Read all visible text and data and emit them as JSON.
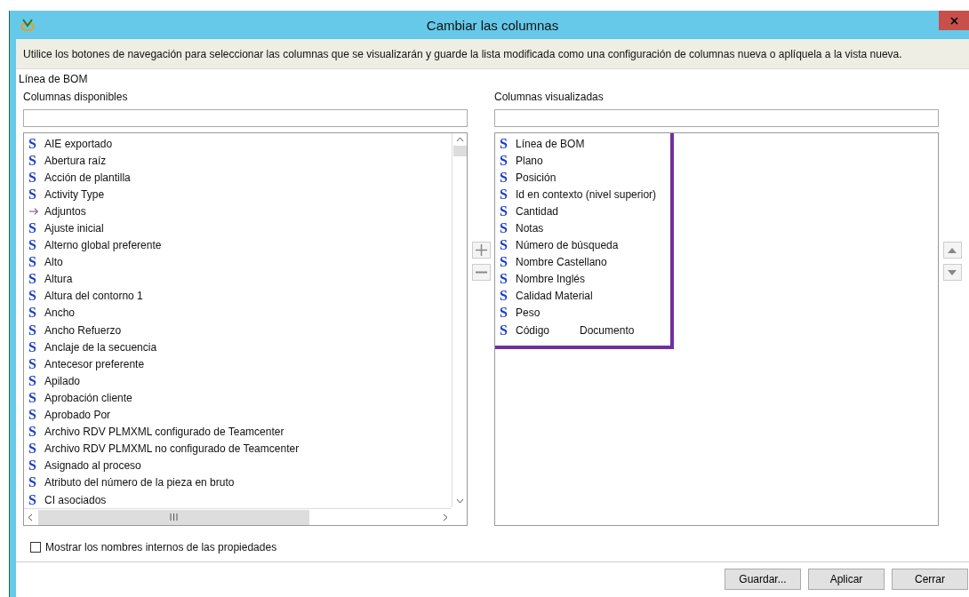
{
  "window": {
    "title": "Cambiar las columnas"
  },
  "instructions": "Utilice los botones de navegación para seleccionar las columnas que se visualizarán y guarde la lista modificada como una configuración de columnas nueva o aplíquela a la vista nueva.",
  "object_type": "Línea de BOM",
  "available": {
    "label": "Columnas disponibles",
    "items": [
      {
        "kind": "string",
        "icon": "S",
        "label": "AIE exportado"
      },
      {
        "kind": "string",
        "icon": "S",
        "label": "Abertura raíz"
      },
      {
        "kind": "string",
        "icon": "S",
        "label": "Acción de plantilla"
      },
      {
        "kind": "string",
        "icon": "S",
        "label": "Activity Type"
      },
      {
        "kind": "reference",
        "label": "Adjuntos"
      },
      {
        "kind": "string",
        "icon": "S",
        "label": "Ajuste inicial"
      },
      {
        "kind": "string",
        "icon": "S",
        "label": "Alterno global preferente"
      },
      {
        "kind": "string",
        "icon": "S",
        "label": "Alto"
      },
      {
        "kind": "string",
        "icon": "S",
        "label": "Altura"
      },
      {
        "kind": "string",
        "icon": "S",
        "label": "Altura del contorno 1"
      },
      {
        "kind": "string",
        "icon": "S",
        "label": "Ancho"
      },
      {
        "kind": "string",
        "icon": "S",
        "label": "Ancho Refuerzo"
      },
      {
        "kind": "string",
        "icon": "S",
        "label": "Anclaje de la secuencia"
      },
      {
        "kind": "string",
        "icon": "S",
        "label": "Antecesor preferente"
      },
      {
        "kind": "string",
        "icon": "S",
        "label": "Apilado"
      },
      {
        "kind": "string",
        "icon": "S",
        "label": "Aprobación cliente"
      },
      {
        "kind": "string",
        "icon": "S",
        "label": "Aprobado Por"
      },
      {
        "kind": "string",
        "icon": "S",
        "label": "Archivo RDV PLMXML configurado de Teamcenter"
      },
      {
        "kind": "string",
        "icon": "S",
        "label": "Archivo RDV PLMXML no configurado de Teamcenter"
      },
      {
        "kind": "string",
        "icon": "S",
        "label": "Asignado al proceso"
      },
      {
        "kind": "string",
        "icon": "S",
        "label": "Atributo del número de la pieza en bruto"
      },
      {
        "kind": "string",
        "icon": "S",
        "label": "CI asociados"
      }
    ]
  },
  "displayed": {
    "label": "Columnas visualizadas",
    "highlighted": true,
    "items": [
      {
        "kind": "string",
        "icon": "S",
        "label": "Línea de BOM"
      },
      {
        "kind": "string",
        "icon": "S",
        "label": "Plano"
      },
      {
        "kind": "string",
        "icon": "S",
        "label": "Posición"
      },
      {
        "kind": "string",
        "icon": "S",
        "label": "Id en contexto (nivel superior)"
      },
      {
        "kind": "string",
        "icon": "S",
        "label": "Cantidad"
      },
      {
        "kind": "string",
        "icon": "S",
        "label": "Notas"
      },
      {
        "kind": "string",
        "icon": "S",
        "label": "Número de búsqueda"
      },
      {
        "kind": "string",
        "icon": "S",
        "label": "Nombre Castellano"
      },
      {
        "kind": "string",
        "icon": "S",
        "label": "Nombre Inglés"
      },
      {
        "kind": "string",
        "icon": "S",
        "label": "Calidad Material"
      },
      {
        "kind": "string",
        "icon": "S",
        "label": "Peso"
      },
      {
        "kind": "string",
        "icon": "S",
        "label": "Código",
        "extra": "Documento"
      }
    ]
  },
  "show_internal_names": {
    "label": "Mostrar los nombres internos de las propiedades",
    "checked": false
  },
  "buttons": [
    "Guardar...",
    "Aplicar",
    "Cerrar"
  ]
}
